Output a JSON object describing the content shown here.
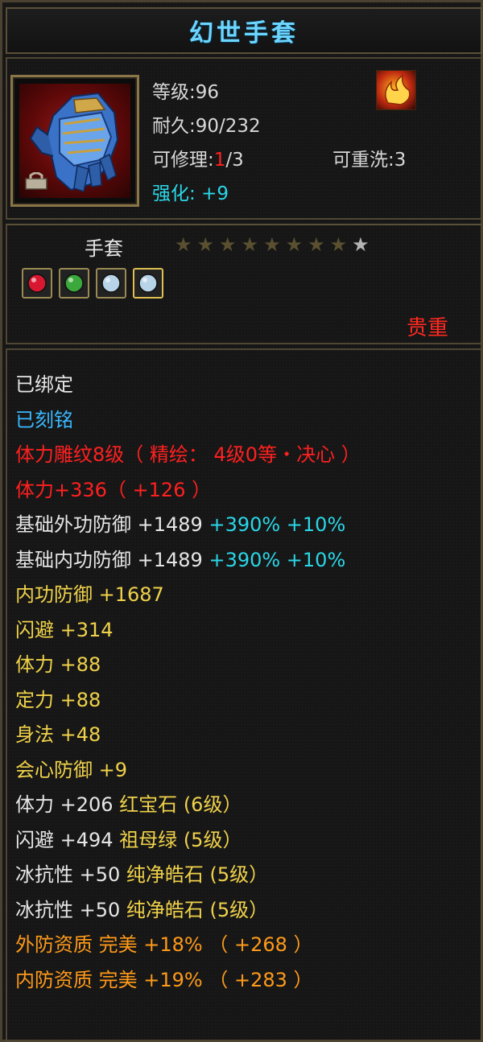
{
  "item": {
    "name": "幻世手套",
    "level_label": "等级",
    "level": "96",
    "durability_label": "耐久",
    "durability": "90/232",
    "repair_label": "可修理",
    "repair_current": "1",
    "repair_total": "/3",
    "rewash_label": "可重洗",
    "rewash": "3",
    "enhance_label": "强化",
    "enhance": "+9",
    "icon": "glove-icon",
    "bind_icon": "lock-icon",
    "badge_icon": "flame-badge-icon"
  },
  "summary": {
    "type": "手套",
    "stars_total": 9,
    "stars_lit": 1,
    "gems": [
      "ruby-gem-icon",
      "emerald-gem-icon",
      "pure-crystal-gem-icon",
      "pure-crystal-gem-icon"
    ],
    "rarity": "贵重"
  },
  "attributes": [
    {
      "segments": [
        {
          "text": "已绑定",
          "color": "white"
        }
      ]
    },
    {
      "segments": [
        {
          "text": "已刻铭",
          "color": "blue"
        }
      ]
    },
    {
      "segments": [
        {
          "text": "体力雕纹8级（ 精绘： 4级0等・决心 ）",
          "color": "red"
        }
      ]
    },
    {
      "segments": [
        {
          "text": "体力+336（ +126 ）",
          "color": "red"
        }
      ]
    },
    {
      "segments": [
        {
          "text": "基础外功防御  +1489 ",
          "color": "white"
        },
        {
          "text": "+390%  +10%",
          "color": "cyan"
        }
      ]
    },
    {
      "segments": [
        {
          "text": "基础内功防御  +1489 ",
          "color": "white"
        },
        {
          "text": "+390%  +10%",
          "color": "cyan"
        }
      ]
    },
    {
      "segments": [
        {
          "text": "内功防御  +1687",
          "color": "yellow"
        }
      ]
    },
    {
      "segments": [
        {
          "text": "闪避  +314",
          "color": "yellow"
        }
      ]
    },
    {
      "segments": [
        {
          "text": "体力  +88",
          "color": "yellow"
        }
      ]
    },
    {
      "segments": [
        {
          "text": "定力  +88",
          "color": "yellow"
        }
      ]
    },
    {
      "segments": [
        {
          "text": "身法  +48",
          "color": "yellow"
        }
      ]
    },
    {
      "segments": [
        {
          "text": "会心防御  +9",
          "color": "yellow"
        }
      ]
    },
    {
      "segments": [
        {
          "text": "体力  +206 ",
          "color": "white"
        },
        {
          "text": "红宝石 (6级）",
          "color": "yellow"
        }
      ]
    },
    {
      "segments": [
        {
          "text": "闪避  +494 ",
          "color": "white"
        },
        {
          "text": "祖母绿 (5级）",
          "color": "yellow"
        }
      ]
    },
    {
      "segments": [
        {
          "text": "冰抗性  +50 ",
          "color": "white"
        },
        {
          "text": "纯净皓石 (5级）",
          "color": "yellow"
        }
      ]
    },
    {
      "segments": [
        {
          "text": "冰抗性  +50 ",
          "color": "white"
        },
        {
          "text": "纯净皓石 (5级）",
          "color": "yellow"
        }
      ]
    },
    {
      "segments": [
        {
          "text": "外防资质   完美  +18% （ +268 ）",
          "color": "orange"
        }
      ]
    },
    {
      "segments": [
        {
          "text": "内防资质   完美  +19% （ +283 ）",
          "color": "orange"
        }
      ]
    }
  ]
}
